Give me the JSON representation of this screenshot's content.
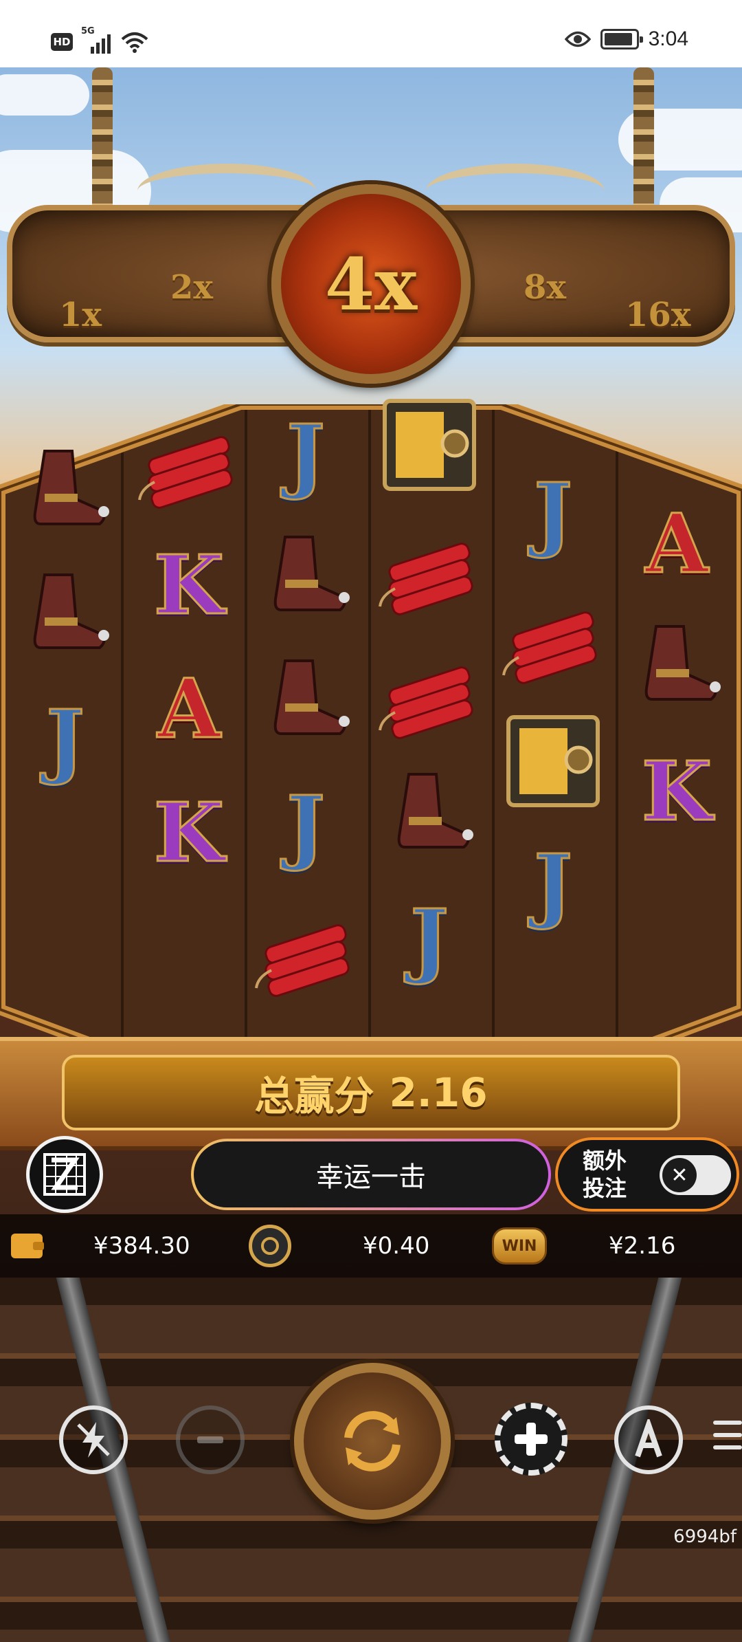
{
  "status_bar": {
    "hd_label": "HD",
    "network_label": "5G",
    "time": "3:04",
    "battery_level_percent": 90
  },
  "multiplier_board": {
    "left_values": [
      "1x",
      "2x"
    ],
    "current": "4x",
    "right_values": [
      "8x",
      "16x"
    ]
  },
  "reels": [
    [
      "boot-icon",
      "boot-icon",
      "J"
    ],
    [
      "dynamite-icon",
      "K",
      "A",
      "K"
    ],
    [
      "J",
      "boot-icon",
      "boot-icon",
      "J",
      "dynamite-icon"
    ],
    [
      "safe-icon",
      "dynamite-icon",
      "dynamite-icon",
      "boot-icon",
      "J"
    ],
    [
      "J",
      "dynamite-icon",
      "safe-icon",
      "J"
    ],
    [
      "A",
      "boot-icon",
      "K"
    ]
  ],
  "total_win": {
    "label": "总赢分",
    "value": "2.16"
  },
  "actions": {
    "lucky_strike_label": "幸运一击",
    "extra_bet_label_line1": "额外",
    "extra_bet_label_line2": "投注",
    "extra_bet_enabled": false
  },
  "info_bar": {
    "balance": "¥384.30",
    "bet": "¥0.40",
    "win": "¥2.16",
    "win_badge": "WIN"
  },
  "controls": {
    "build_id": "6994bf"
  },
  "colors": {
    "accent_gold": "#f2c45a",
    "multiplier_red": "#c8400f",
    "extra_bet_border": "#f08a24"
  }
}
